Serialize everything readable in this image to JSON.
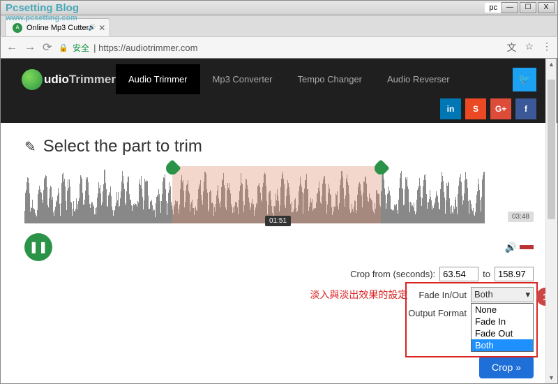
{
  "watermark": {
    "line1": "Pcsetting Blog",
    "line2": "www.pcsetting.com"
  },
  "window": {
    "title": "pc",
    "buttons": [
      "—",
      "☐",
      "X"
    ]
  },
  "tab": {
    "title": "Online Mp3 Cutter",
    "sound_icon": "🔊",
    "close": "✕"
  },
  "address": {
    "secure": "安全",
    "url_prefix": "https://",
    "url_host": "audiotrimmer.com"
  },
  "logo": {
    "text1": "udio",
    "text2": "Trimmer"
  },
  "nav": [
    "Audio Trimmer",
    "Mp3 Converter",
    "Tempo Changer",
    "Audio Reverser"
  ],
  "social": {
    "twitter": "🐦",
    "linkedin": "in",
    "stumble": "S",
    "gplus": "G+",
    "fb": "f"
  },
  "heading": "Select the part to trim",
  "waveform": {
    "selection_start_pct": 29,
    "selection_end_pct": 70,
    "time_current": "01:51",
    "time_total": "03:48"
  },
  "play_icon": "❚❚",
  "volume_icon": "🔊",
  "form": {
    "crop_label": "Crop from (seconds):",
    "crop_from": "63.54",
    "to_label": "to",
    "crop_to": "158.97",
    "fade_annotation": "淡入與淡出效果的設定",
    "fade_label": "Fade In/Out",
    "fade_value": "Both",
    "output_label": "Output Format",
    "options": [
      "None",
      "Fade In",
      "Fade Out",
      "Both"
    ],
    "crop_button": "Crop »"
  },
  "marker": "1"
}
